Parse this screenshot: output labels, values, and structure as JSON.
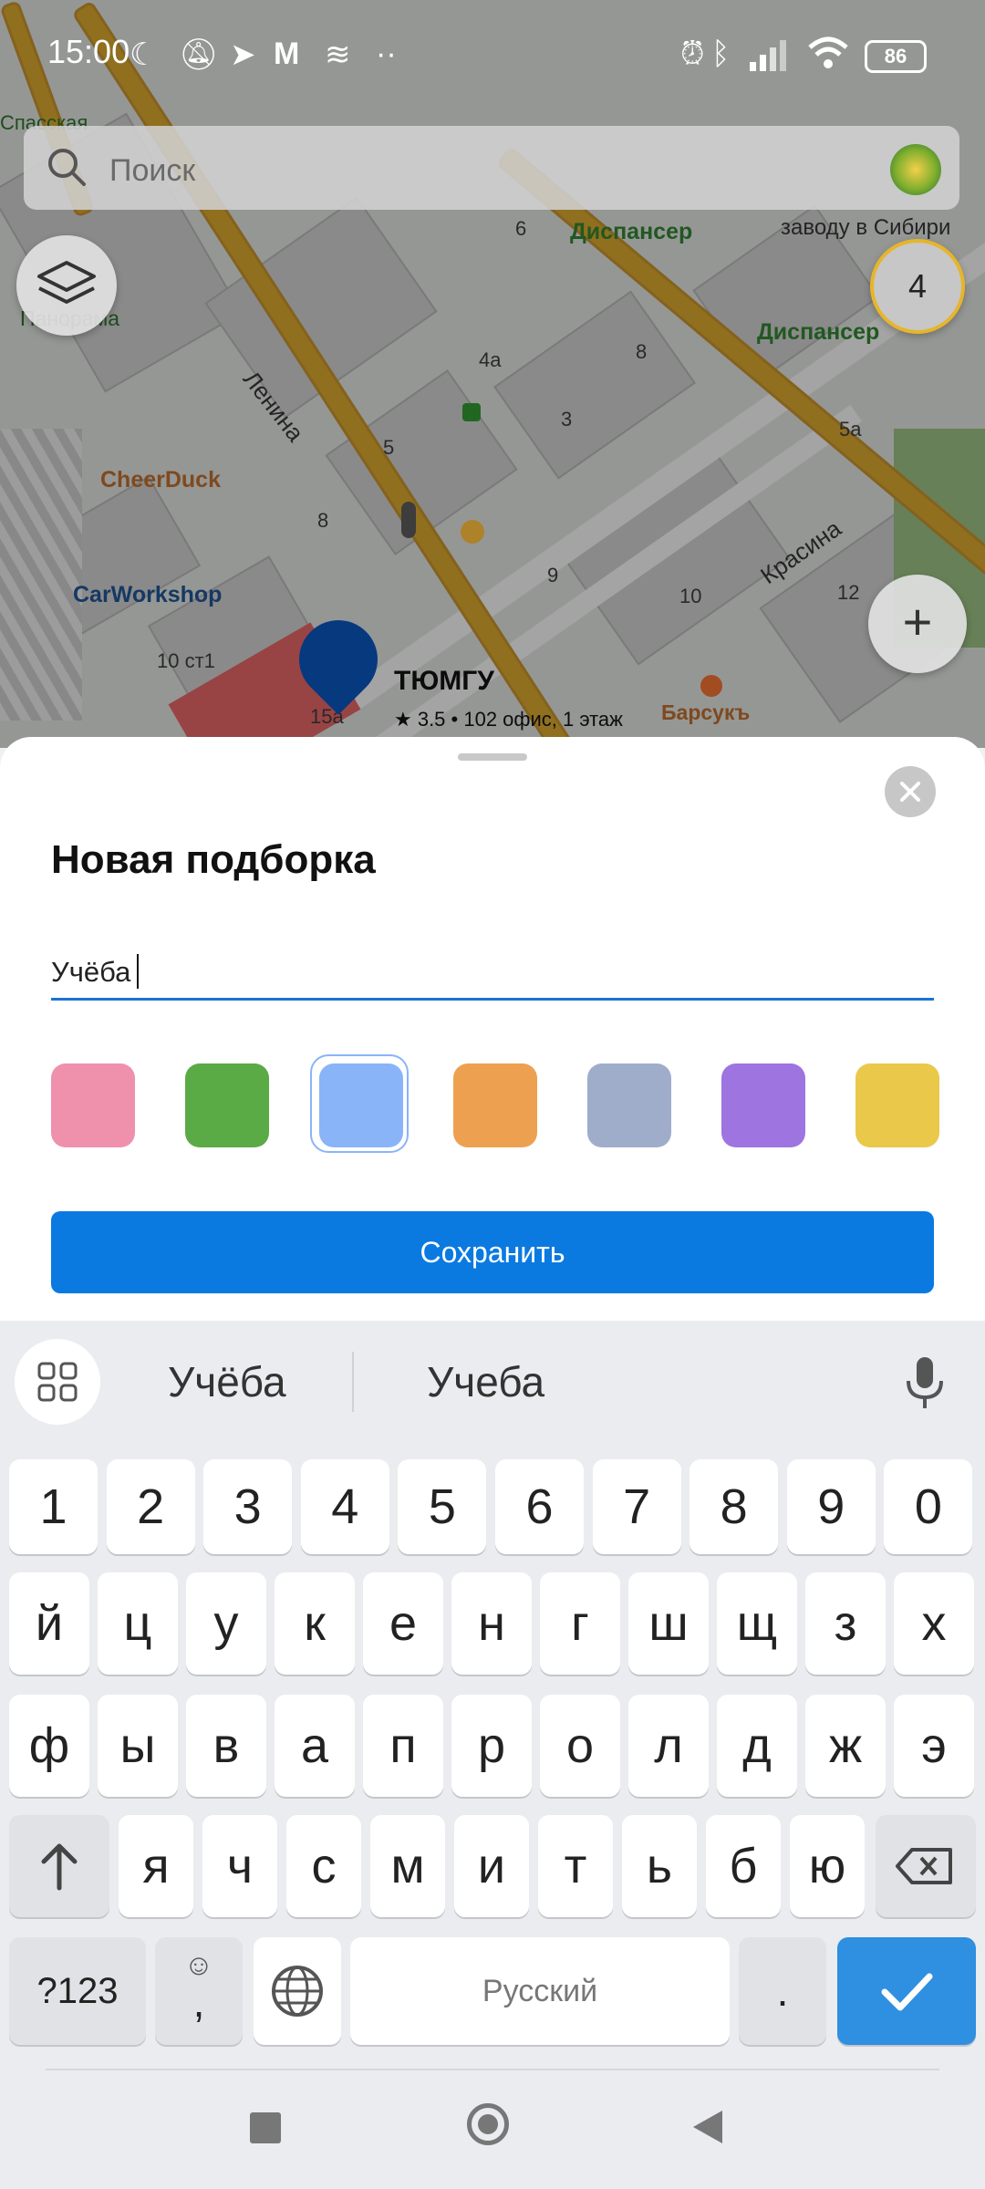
{
  "status_bar": {
    "time": "15:00",
    "battery": "86"
  },
  "map": {
    "streets": [
      "Ленина",
      "Красина"
    ],
    "places": [
      "Спасская",
      "Панорама",
      "CheerDuck",
      "CarWorkshop",
      "Барсукъ",
      "Диспансер",
      "Диспансер"
    ],
    "selected_place": {
      "name": "ТЮМГУ",
      "details": "★ 3.5 • 102 офис, 1 этаж"
    },
    "road_label": "заводу в Сибири",
    "house_numbers": [
      "6",
      "4а",
      "8",
      "3",
      "5",
      "8",
      "9",
      "10",
      "12",
      "5а",
      "10 ст1",
      "15а"
    ],
    "cluster_count": "4"
  },
  "search": {
    "placeholder": "Поиск"
  },
  "sheet": {
    "title": "Новая подборка",
    "input_value": "Учёба",
    "colors": [
      "#ef90ad",
      "#5aaa45",
      "#8ab4f8",
      "#eea051",
      "#9fadcb",
      "#9e74e0",
      "#e9c84a"
    ],
    "selected_color_index": 2,
    "save_label": "Сохранить"
  },
  "keyboard": {
    "suggestions": [
      "Учёба",
      "Учеба"
    ],
    "row_digits": [
      "1",
      "2",
      "3",
      "4",
      "5",
      "6",
      "7",
      "8",
      "9",
      "0"
    ],
    "row1": [
      "й",
      "ц",
      "у",
      "к",
      "е",
      "н",
      "г",
      "ш",
      "щ",
      "з",
      "х"
    ],
    "row2": [
      "ф",
      "ы",
      "в",
      "а",
      "п",
      "р",
      "о",
      "л",
      "д",
      "ж",
      "э"
    ],
    "row3": [
      "я",
      "ч",
      "с",
      "м",
      "и",
      "т",
      "ь",
      "б",
      "ю"
    ],
    "symbols_key": "?123",
    "emoji_comma": ",",
    "space_label": "Русский",
    "period": "."
  }
}
